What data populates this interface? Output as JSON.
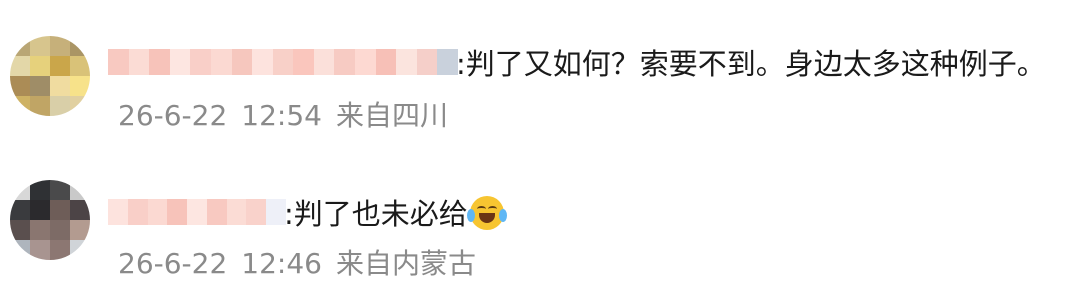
{
  "comments": [
    {
      "username": "(pixelated)",
      "separator": ":",
      "text": "判了又如何？索要不到。身边太多这种例子。",
      "date": "26-6-22",
      "time": "12:54",
      "location": "来自四川",
      "avatar_colors": [
        "#b9a675",
        "#d7c58d",
        "#c6b07a",
        "#aa9565",
        "#e3d7a8",
        "#e6d17c",
        "#caa64a",
        "#d9c278",
        "#ab8c56",
        "#9f8d67",
        "#f0dca0",
        "#f7e28a",
        "#ceb264",
        "#c0a565",
        "#d9cfa8",
        "#e1d0a0",
        "#ddc487",
        "#bba772",
        "#ef9c86",
        "#f39b85"
      ],
      "mosaic_colors": [
        "#f8c9c1",
        "#fbdcd5",
        "#f7c3ba",
        "#fde6e1",
        "#f9cfc8",
        "#fbd9d2",
        "#f6c7be",
        "#fde3de",
        "#f8d0c8",
        "#fac6bd",
        "#fbe0da",
        "#f7cbc3",
        "#fdd9d2",
        "#f7c0b7",
        "#fbe4de",
        "#f5cfc9",
        "#c9d1dc"
      ]
    },
    {
      "username": "(pixelated)",
      "separator": ":",
      "text": "判了也未必给",
      "emoji": "tears-of-joy-emoji",
      "date": "26-6-22",
      "time": "12:46",
      "location": "来自内蒙古",
      "avatar_colors": [
        "#d8d8d8",
        "#2f3134",
        "#4a4a4b",
        "#c9c9c9",
        "#3a3b3e",
        "#2b2a2d",
        "#6e5d58",
        "#4c4446",
        "#5a4f4e",
        "#8a7670",
        "#7d6b66",
        "#b39b90",
        "#aeb5bd",
        "#a89490",
        "#8c7772",
        "#d0d4d8",
        "#c7c0bf",
        "#b8aaa5",
        "#9e8f8c",
        "#e1e1e1"
      ],
      "mosaic_colors": [
        "#fde3de",
        "#f9cfc8",
        "#fbd9d2",
        "#f7c3ba",
        "#fde6e1",
        "#f8c9c1",
        "#fbdcd5",
        "#f9d2cb",
        "#eef0f8"
      ]
    }
  ]
}
